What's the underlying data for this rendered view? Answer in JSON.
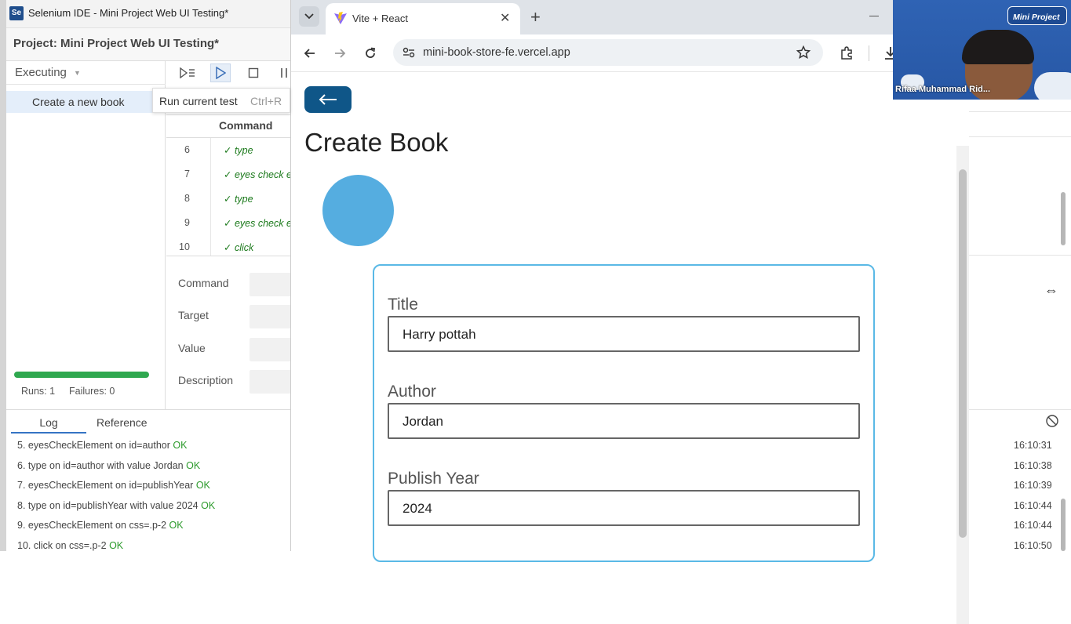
{
  "ide": {
    "window_title": "Selenium IDE - Mini Project Web UI Testing*",
    "logo_text": "Se",
    "project_label": "Project:  Mini Project Web UI Testing*",
    "executing_label": "Executing",
    "test_name": "Create a new book",
    "tooltip": {
      "text": "Run current test",
      "shortcut": "Ctrl+R"
    },
    "behind_tooltip_fragment": "e.",
    "command_header": "Command",
    "commands": [
      {
        "num": "6",
        "text": "✓ type"
      },
      {
        "num": "7",
        "text": "✓ eyes check el"
      },
      {
        "num": "8",
        "text": "✓ type"
      },
      {
        "num": "9",
        "text": "✓ eyes check el"
      },
      {
        "num": "10",
        "text": "✓ click"
      }
    ],
    "fields": {
      "command": "Command",
      "target": "Target",
      "value": "Value",
      "description": "Description"
    },
    "runs_text": "Runs: 1",
    "failures_text": "Failures: 0",
    "progress": 1.0,
    "tabs": {
      "log": "Log",
      "reference": "Reference"
    },
    "log": [
      {
        "text": "5.   eyesCheckElement on id=author",
        "status": "OK",
        "time": "16:10:31"
      },
      {
        "text": "6.   type on id=author with value Jordan",
        "status": "OK",
        "time": "16:10:38"
      },
      {
        "text": "7.   eyesCheckElement on id=publishYear",
        "status": "OK",
        "time": "16:10:39"
      },
      {
        "text": "8.   type on id=publishYear with value 2024",
        "status": "OK",
        "time": "16:10:44"
      },
      {
        "text": "9.   eyesCheckElement on css=.p-2",
        "status": "OK",
        "time": "16:10:44"
      },
      {
        "text": "10.  click on css=.p-2",
        "status": "OK",
        "time": "16:10:50"
      }
    ]
  },
  "browser": {
    "tab_title": "Vite + React",
    "url": "mini-book-store-fe.vercel.app",
    "page": {
      "title": "Create Book",
      "form": {
        "title_label": "Title",
        "title_value": "Harry pottah",
        "author_label": "Author",
        "author_value": "Jordan",
        "year_label": "Publish Year",
        "year_value": "2024"
      }
    }
  },
  "video": {
    "badge": "Mini Project",
    "participant_name": "Rifaa Muhammad Rid..."
  },
  "colors": {
    "accent_button": "#0f5688",
    "avatar": "#55ade0",
    "card_border": "#5ab9e6",
    "ok_green": "#2b9a2b",
    "progress": "#2fa84f"
  }
}
